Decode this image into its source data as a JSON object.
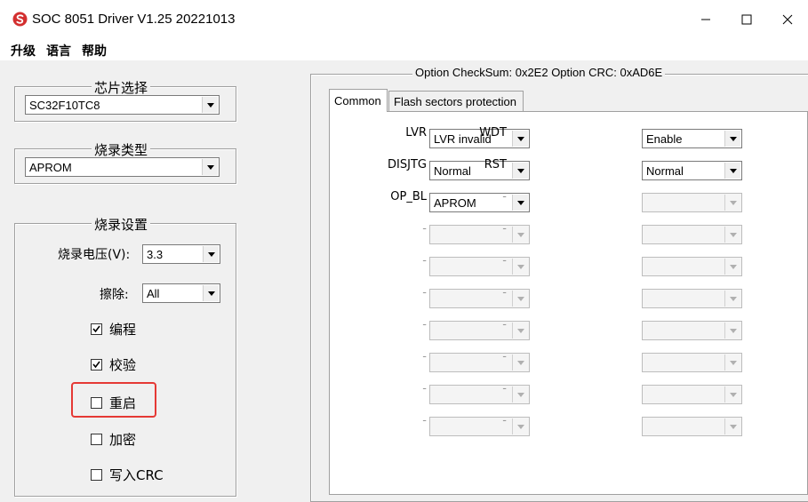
{
  "window": {
    "title": "SOC 8051 Driver V1.25 20221013"
  },
  "menu": [
    "升级",
    "语言",
    "帮助"
  ],
  "chip_select": {
    "title": "芯片选择",
    "value": "SC32F10TC8"
  },
  "burn_type": {
    "title": "烧录类型",
    "value": "APROM"
  },
  "burn_settings": {
    "title": "烧录设置",
    "voltage_label": "烧录电压(V):",
    "voltage_value": "3.3",
    "erase_label": "擦除:",
    "erase_value": "All",
    "checkboxes": [
      {
        "label": "编程",
        "checked": true
      },
      {
        "label": "校验",
        "checked": true
      },
      {
        "label": "重启",
        "checked": false
      },
      {
        "label": "加密",
        "checked": false
      },
      {
        "label": "写入CRC",
        "checked": false
      }
    ]
  },
  "options": {
    "header": "Option CheckSum: 0x2E2 Option CRC: 0xAD6E",
    "tabs": [
      "Common",
      "Flash sectors protection"
    ],
    "left": [
      {
        "label": "LVR",
        "value": "LVR invalid"
      },
      {
        "label": "DISJTG",
        "value": "Normal"
      },
      {
        "label": "OP_BL",
        "value": "APROM"
      },
      {
        "label": "-",
        "value": ""
      },
      {
        "label": "-",
        "value": ""
      },
      {
        "label": "-",
        "value": ""
      },
      {
        "label": "-",
        "value": ""
      },
      {
        "label": "-",
        "value": ""
      },
      {
        "label": "-",
        "value": ""
      },
      {
        "label": "-",
        "value": ""
      }
    ],
    "right": [
      {
        "label": "WDT",
        "value": "Enable"
      },
      {
        "label": "RST",
        "value": "Normal"
      },
      {
        "label": "-",
        "value": ""
      },
      {
        "label": "-",
        "value": ""
      },
      {
        "label": "-",
        "value": ""
      },
      {
        "label": "-",
        "value": ""
      },
      {
        "label": "-",
        "value": ""
      },
      {
        "label": "-",
        "value": ""
      },
      {
        "label": "-",
        "value": ""
      },
      {
        "label": "-",
        "value": ""
      }
    ]
  },
  "colors": {
    "highlight": "#e53935",
    "logo": "#d32f2f"
  }
}
